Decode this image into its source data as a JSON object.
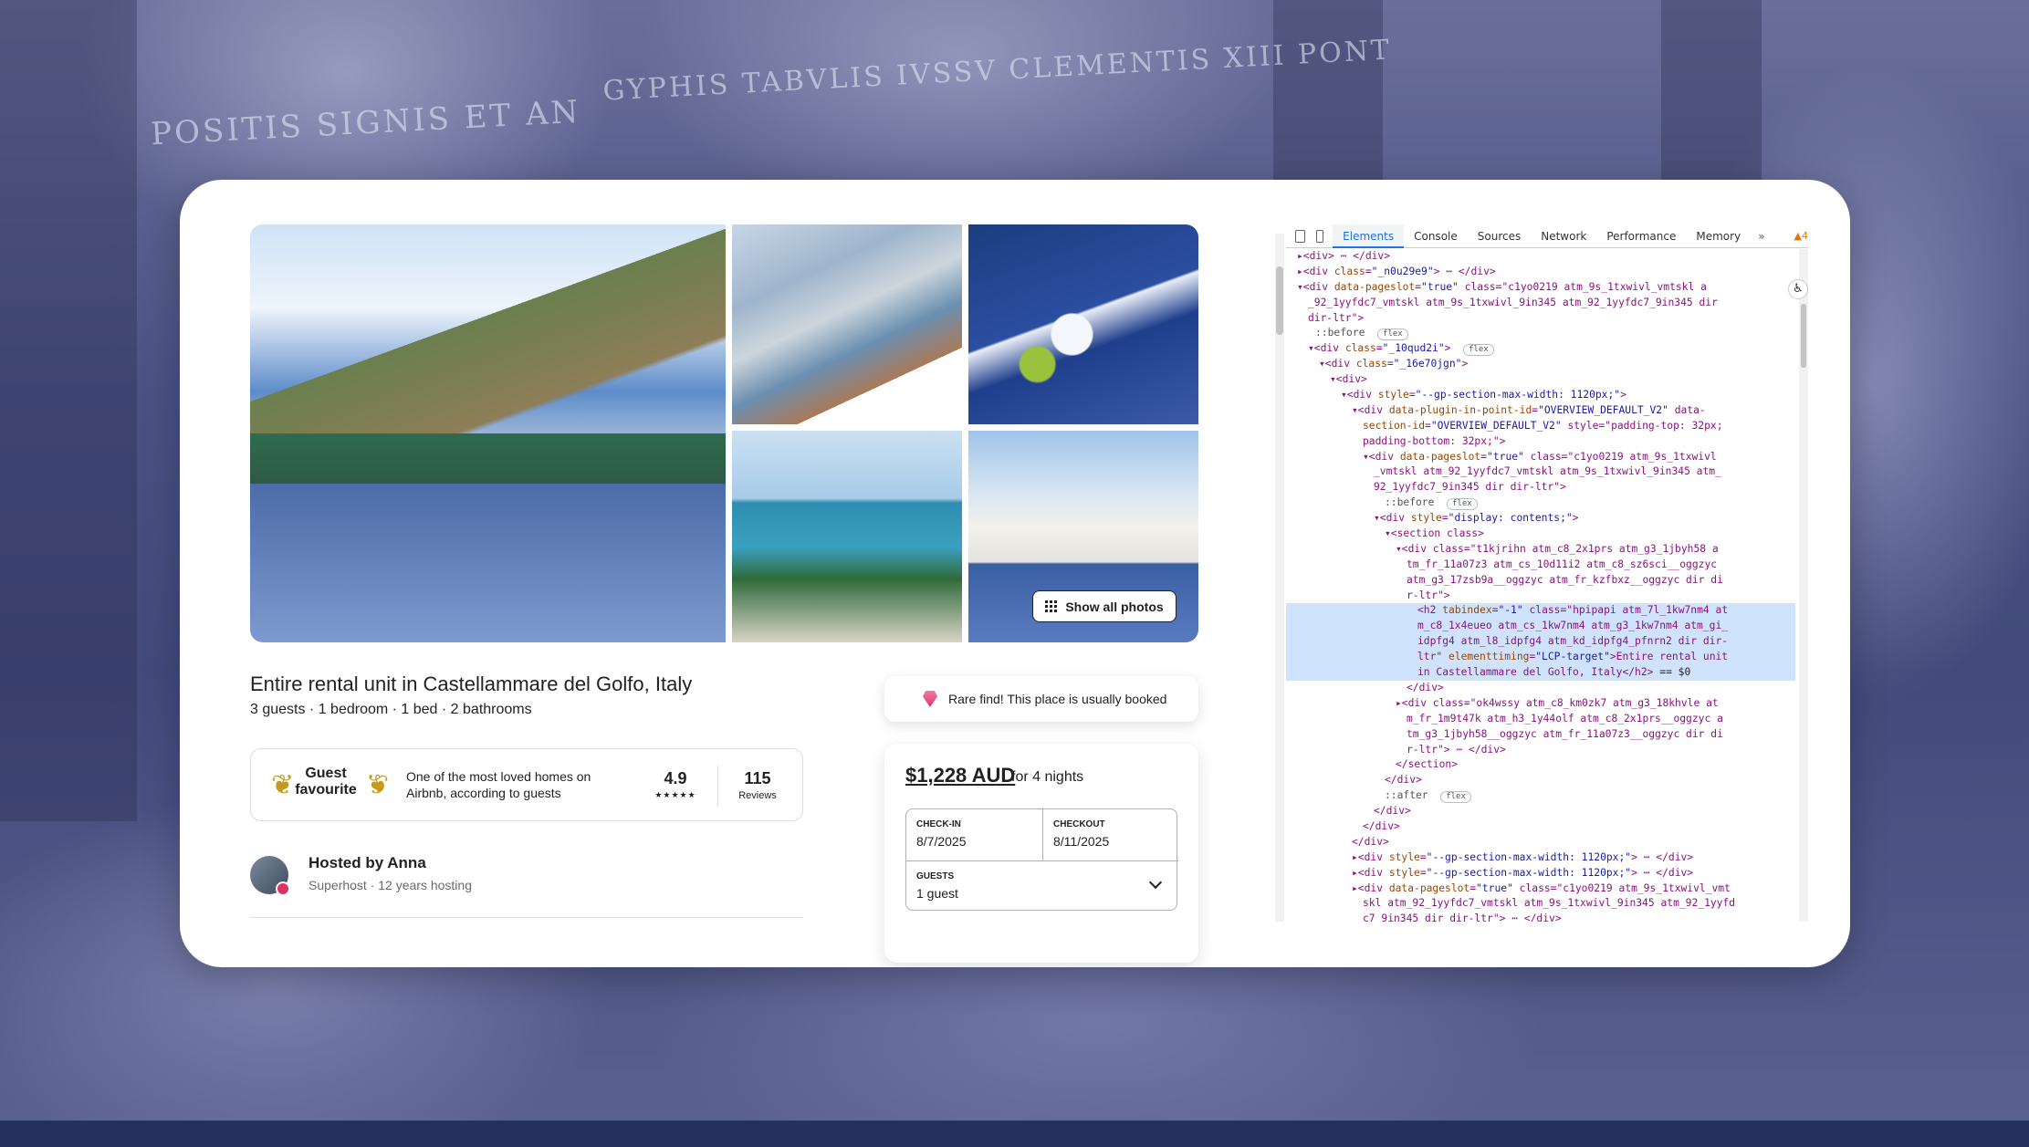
{
  "background": {
    "inscriptions": [
      "POSITIS SIGNIS ET AN",
      "GYPHIS TABVLIS IVSSV CLEMENTIS XIII PONT"
    ]
  },
  "listing": {
    "photos": [
      {
        "name": "main",
        "alt": ""
      },
      {
        "name": "thumb-1",
        "alt": ""
      },
      {
        "name": "thumb-2",
        "alt": ""
      },
      {
        "name": "thumb-3",
        "alt": ""
      },
      {
        "name": "thumb-4",
        "alt": ""
      }
    ],
    "show_all_photos": "Show all photos",
    "title": "Entire rental unit in Castellammare del Golfo, Italy",
    "subtitle": "3 guests · 1 bedroom · 1 bed · 2 bathrooms",
    "guest_favourite": {
      "label_line1": "Guest",
      "label_line2": "favourite",
      "description": "One of the most loved homes on Airbnb, according to guests",
      "rating": "4.9",
      "stars": "★★★★★",
      "reviews_count": "115",
      "reviews_label": "Reviews"
    },
    "host": {
      "name": "Hosted by Anna",
      "details": "Superhost · 12 years hosting"
    },
    "rare_find": "Rare find! This place is usually booked",
    "booking": {
      "price": "$1,228 AUD",
      "price_suffix": "for 4 nights",
      "checkin_label": "CHECK-IN",
      "checkin_value": "8/7/2025",
      "checkout_label": "CHECKOUT",
      "checkout_value": "8/11/2025",
      "guests_label": "GUESTS",
      "guests_value": "1 guest"
    }
  },
  "devtools": {
    "tabs": [
      "Elements",
      "Console",
      "Sources",
      "Network",
      "Performance",
      "Memory"
    ],
    "more": "»",
    "warning": "▲4",
    "lines": [
      {
        "indent": 72,
        "text": "▸<div> ⋯ </div>"
      },
      {
        "indent": 72,
        "text": "▸<div class=\"_n0u29e9\"> ⋯ </div>"
      },
      {
        "indent": 72,
        "text": "▾<div data-pageslot=\"true\" class=\"c1yo0219 atm_9s_1txwivl_vmtskl a"
      },
      {
        "indent": 84,
        "text": "_92_1yyfdc7_vmtskl atm_9s_1txwivl_9in345 atm_92_1yyfdc7_9in345 dir"
      },
      {
        "indent": 84,
        "text": "dir-ltr\">"
      },
      {
        "indent": 92,
        "text": "::before  flex"
      },
      {
        "indent": 84,
        "text": "▾<div class=\"_10qud2i\">  flex"
      },
      {
        "indent": 96,
        "text": "▾<div class=\"_16e70jgn\">"
      },
      {
        "indent": 108,
        "text": "▾<div>"
      },
      {
        "indent": 120,
        "text": "▾<div style=\"--gp-section-max-width: 1120px;\">"
      },
      {
        "indent": 132,
        "text": "▾<div data-plugin-in-point-id=\"OVERVIEW_DEFAULT_V2\" data-"
      },
      {
        "indent": 144,
        "text": "section-id=\"OVERVIEW_DEFAULT_V2\" style=\"padding-top: 32px;"
      },
      {
        "indent": 144,
        "text": "padding-bottom: 32px;\">"
      },
      {
        "indent": 144,
        "text": "▾<div data-pageslot=\"true\" class=\"c1yo0219 atm_9s_1txwivl"
      },
      {
        "indent": 156,
        "text": "_vmtskl atm_92_1yyfdc7_vmtskl atm_9s_1txwivl_9in345 atm_"
      },
      {
        "indent": 156,
        "text": "92_1yyfdc7_9in345 dir dir-ltr\">"
      },
      {
        "indent": 168,
        "text": "::before  flex"
      },
      {
        "indent": 156,
        "text": "▾<div style=\"display: contents;\">"
      },
      {
        "indent": 168,
        "text": "▾<section class>"
      },
      {
        "indent": 180,
        "text": "▾<div class=\"t1kjrihn atm_c8_2x1prs atm_g3_1jbyh58 a"
      },
      {
        "indent": 192,
        "text": "tm_fr_11a07z3 atm_cs_10d11i2 atm_c8_sz6sci__oggzyc"
      },
      {
        "indent": 192,
        "text": "atm_g3_17zsb9a__oggzyc atm_fr_kzfbxz__oggzyc dir di"
      },
      {
        "indent": 192,
        "text": "r-ltr\">"
      },
      {
        "indent": 204,
        "text": "<h2 tabindex=\"-1\" class=\"hpipapi atm_7l_1kw7nm4 at",
        "hl": true
      },
      {
        "indent": 204,
        "text": "m_c8_1x4eueo atm_cs_1kw7nm4 atm_g3_1kw7nm4 atm_gi_",
        "hl": true
      },
      {
        "indent": 204,
        "text": "idpfg4 atm_l8_idpfg4 atm_kd_idpfg4_pfnrn2 dir dir-",
        "hl": true
      },
      {
        "indent": 204,
        "text": "ltr\" elementtiming=\"LCP-target\">Entire rental unit",
        "hl": true
      },
      {
        "indent": 204,
        "text": "in Castellammare del Golfo, Italy</h2> == $0",
        "hl": true
      },
      {
        "indent": 192,
        "text": "</div>"
      },
      {
        "indent": 180,
        "text": "▸<div class=\"ok4wssy atm_c8_km0zk7 atm_g3_18khvle at"
      },
      {
        "indent": 192,
        "text": "m_fr_1m9t47k atm_h3_1y44olf atm_c8_2x1prs__oggzyc a"
      },
      {
        "indent": 192,
        "text": "tm_g3_1jbyh58__oggzyc atm_fr_11a07z3__oggzyc dir di"
      },
      {
        "indent": 192,
        "text": "r-ltr\"> ⋯ </div>"
      },
      {
        "indent": 180,
        "text": "</section>"
      },
      {
        "indent": 168,
        "text": "</div>"
      },
      {
        "indent": 168,
        "text": "::after  flex"
      },
      {
        "indent": 156,
        "text": "</div>"
      },
      {
        "indent": 144,
        "text": "</div>"
      },
      {
        "indent": 132,
        "text": "</div>"
      },
      {
        "indent": 132,
        "text": "▸<div style=\"--gp-section-max-width: 1120px;\"> ⋯ </div>"
      },
      {
        "indent": 132,
        "text": "▸<div style=\"--gp-section-max-width: 1120px;\"> ⋯ </div>"
      },
      {
        "indent": 132,
        "text": "▸<div data-pageslot=\"true\" class=\"c1yo0219 atm_9s_1txwivl_vmt"
      },
      {
        "indent": 144,
        "text": "skl atm_92_1yyfdc7_vmtskl atm_9s_1txwivl_9in345 atm_92_1yyfd"
      },
      {
        "indent": 144,
        "text": "c7_9in345 dir dir-ltr\"> ⋯ </div>"
      }
    ]
  }
}
